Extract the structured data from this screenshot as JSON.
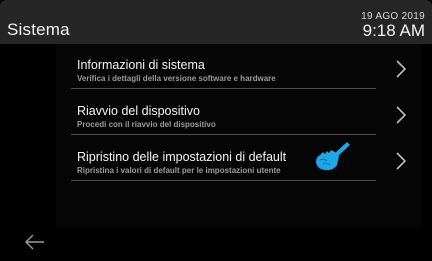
{
  "header": {
    "title": "Sistema",
    "date": "19 AGO 2019",
    "time": "9:18 AM"
  },
  "menu": {
    "items": [
      {
        "title": "Informazioni di sistema",
        "subtitle": "Verifica i dettagli della versione software e hardware"
      },
      {
        "title": "Riavvio del dispositivo",
        "subtitle": "Procedi con il riavvio del dispositivo"
      },
      {
        "title": "Ripristino delle impostazioni di default",
        "subtitle": "Ripristina i valori di default per le impostazioni utente"
      }
    ]
  },
  "icons": {
    "chevron": "chevron-right-icon",
    "pointer": "hand-pointer-icon",
    "back": "back-arrow-icon"
  },
  "colors": {
    "header_background": "#262626",
    "background": "#000000",
    "divider": "#4d4d4d",
    "pointer_accent": "#1ba8e8"
  }
}
